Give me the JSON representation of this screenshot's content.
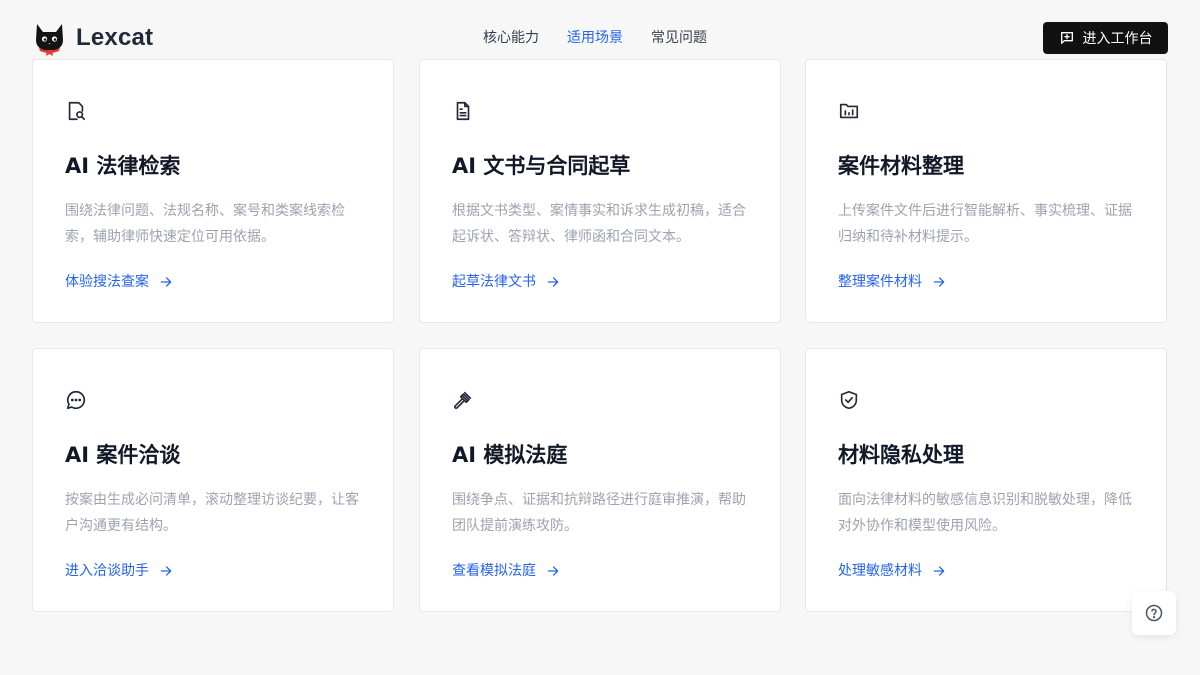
{
  "brand": {
    "name": "Lexcat",
    "logo": "black-cat-logo"
  },
  "nav": {
    "items": [
      "核心能力",
      "适用场景",
      "常见问题"
    ],
    "active_index": 1
  },
  "header": {
    "cta_label": "进入工作台",
    "cta_icon": "message-plus-icon"
  },
  "cards": [
    {
      "icon": "document-search-icon",
      "title": "AI 法律检索",
      "desc": "围绕法律问题、法规名称、案号和类案线索检索，辅助律师快速定位可用依据。",
      "link": "体验搜法查案"
    },
    {
      "icon": "document-text-icon",
      "title": "AI 文书与合同起草",
      "desc": "根据文书类型、案情事实和诉求生成初稿，适合起诉状、答辩状、律师函和合同文本。",
      "link": "起草法律文书"
    },
    {
      "icon": "folder-chart-icon",
      "title": "案件材料整理",
      "desc": "上传案件文件后进行智能解析、事实梳理、证据归纳和待补材料提示。",
      "link": "整理案件材料"
    },
    {
      "icon": "chat-bubble-icon",
      "title": "AI 案件洽谈",
      "desc": "按案由生成必问清单，滚动整理访谈纪要，让客户沟通更有结构。",
      "link": "进入洽谈助手"
    },
    {
      "icon": "gavel-icon",
      "title": "AI 模拟法庭",
      "desc": "围绕争点、证据和抗辩路径进行庭审推演，帮助团队提前演练攻防。",
      "link": "查看模拟法庭"
    },
    {
      "icon": "shield-check-icon",
      "title": "材料隐私处理",
      "desc": "面向法律材料的敏感信息识别和脱敏处理，降低对外协作和模型使用风险。",
      "link": "处理敏感材料"
    }
  ],
  "help": {
    "icon": "help-circle-icon"
  },
  "colors": {
    "accent": "#2563eb",
    "cta_bg": "#111111",
    "background": "#f7f7f8"
  }
}
